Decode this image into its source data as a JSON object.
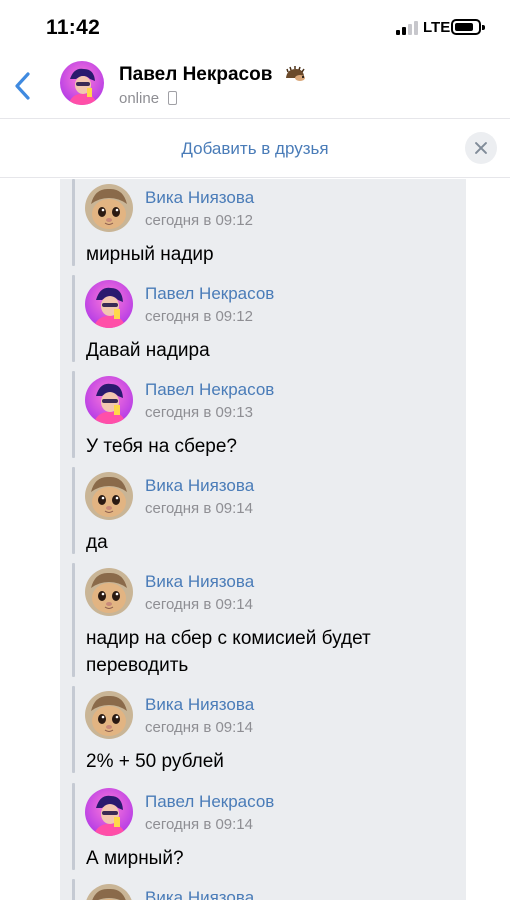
{
  "status_bar": {
    "time": "11:42",
    "network": "LTE",
    "icons": [
      "cellular-signal-icon",
      "battery-icon"
    ]
  },
  "header": {
    "name": "Павел Некрасов",
    "status": "online",
    "icons": [
      "back-chevron-icon",
      "hedgehog-emoji-icon",
      "mobile-phone-icon"
    ]
  },
  "add_friend": {
    "label": "Добавить в друзья",
    "close_icon": "close-icon"
  },
  "colors": {
    "link_blue": "#4a7cb8",
    "timestamp_gray": "#8e8e93",
    "forward_panel": "#ebedf0",
    "close_button_bg": "#eceef1"
  },
  "messages": [
    {
      "author": "Вика Ниязова",
      "time": "сегодня в 09:12",
      "text": "мирный надир",
      "avatar": "cat-avatar"
    },
    {
      "author": "Павел Некрасов",
      "time": "сегодня в 09:12",
      "text": "Давай надира",
      "avatar": "person-avatar"
    },
    {
      "author": "Павел Некрасов",
      "time": "сегодня в 09:13",
      "text": "У тебя на сбере?",
      "avatar": "person-avatar"
    },
    {
      "author": "Вика Ниязова",
      "time": "сегодня в 09:14",
      "text": "да",
      "avatar": "cat-avatar"
    },
    {
      "author": "Вика Ниязова",
      "time": "сегодня в 09:14",
      "text": "надир на сбер с комисией будет переводить",
      "avatar": "cat-avatar"
    },
    {
      "author": "Вика Ниязова",
      "time": "сегодня в 09:14",
      "text": "2% + 50 рублей",
      "avatar": "cat-avatar"
    },
    {
      "author": "Павел Некрасов",
      "time": "сегодня в 09:14",
      "text": "А мирный?",
      "avatar": "person-avatar"
    },
    {
      "author": "Вика Ниязова",
      "time": "",
      "text": "",
      "avatar": "cat-avatar"
    }
  ]
}
